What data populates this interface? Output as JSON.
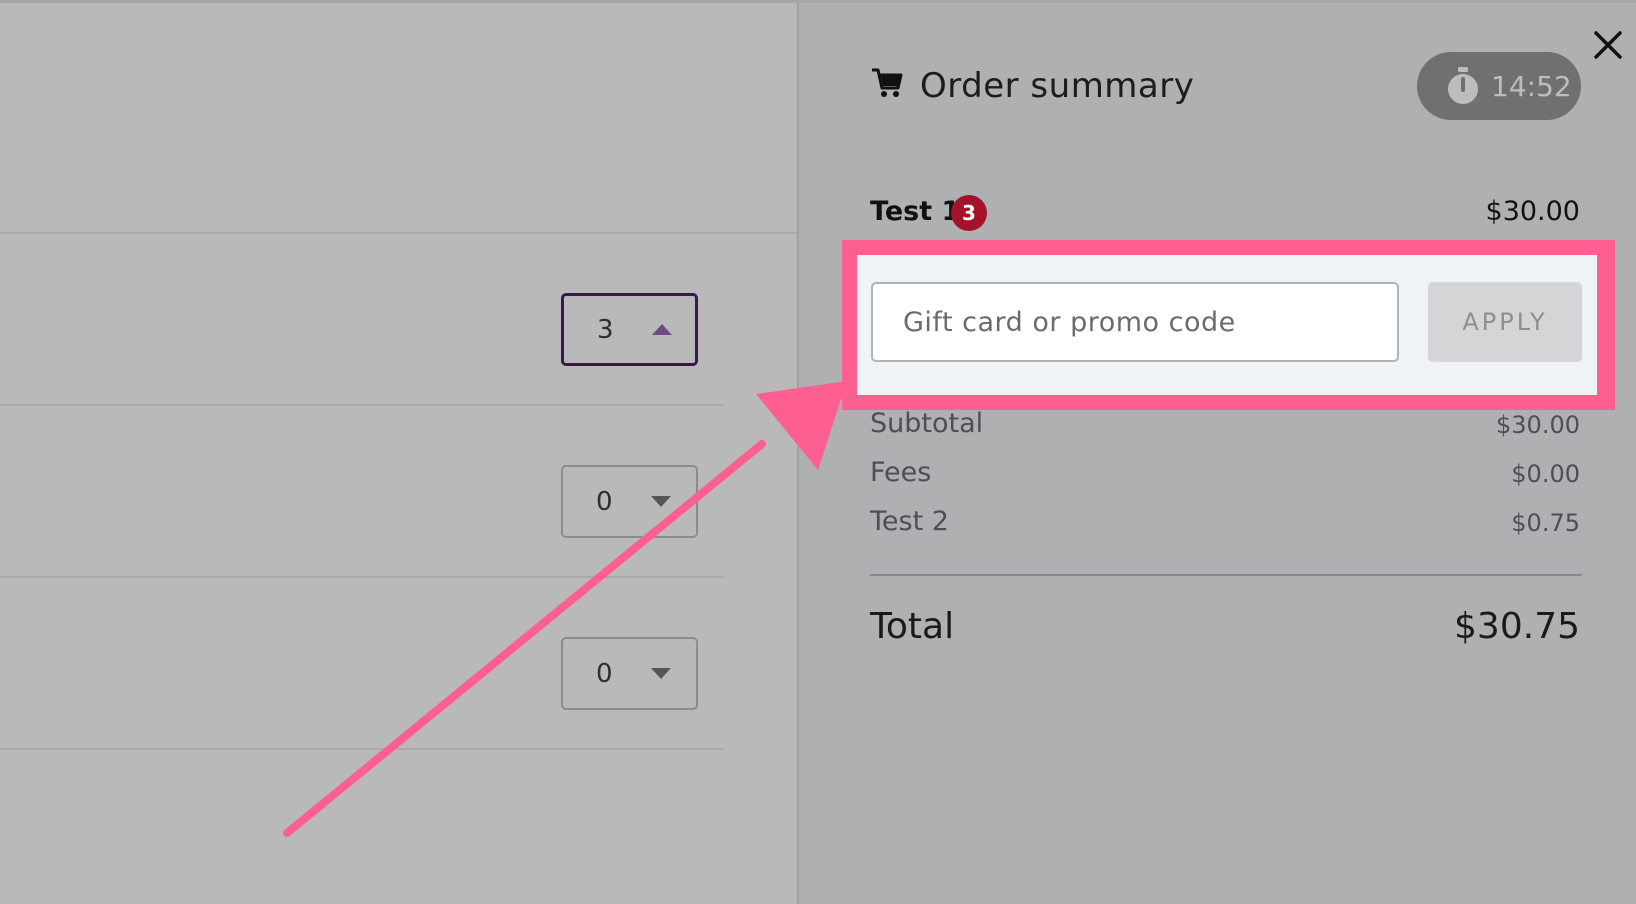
{
  "ticket_rows": [
    {
      "quantity": "3",
      "caret": "up"
    },
    {
      "quantity": "0",
      "caret": "down"
    },
    {
      "quantity": "0",
      "caret": "down"
    }
  ],
  "summary": {
    "title": "Order summary",
    "timer": "14:52",
    "item": {
      "name": "Test 1",
      "count": "3",
      "price": "$30.00"
    },
    "promo": {
      "placeholder": "Gift card or promo code",
      "apply_label": "APPLY"
    },
    "lines": [
      {
        "label": "Subtotal",
        "value": "$30.00"
      },
      {
        "label": "Fees",
        "value": "$0.00"
      },
      {
        "label": "Test 2",
        "value": "$0.75"
      }
    ],
    "total": {
      "label": "Total",
      "value": "$30.75"
    }
  },
  "icons": {
    "close": "close-icon",
    "cart": "cart-icon",
    "timer": "stopwatch-icon",
    "caret_up": "caret-up-icon",
    "caret_down": "caret-down-icon"
  },
  "colors": {
    "highlight": "#fe5f91",
    "badge": "#a3132a",
    "active_border": "#3a1656",
    "timer_bg": "#6f706f"
  }
}
